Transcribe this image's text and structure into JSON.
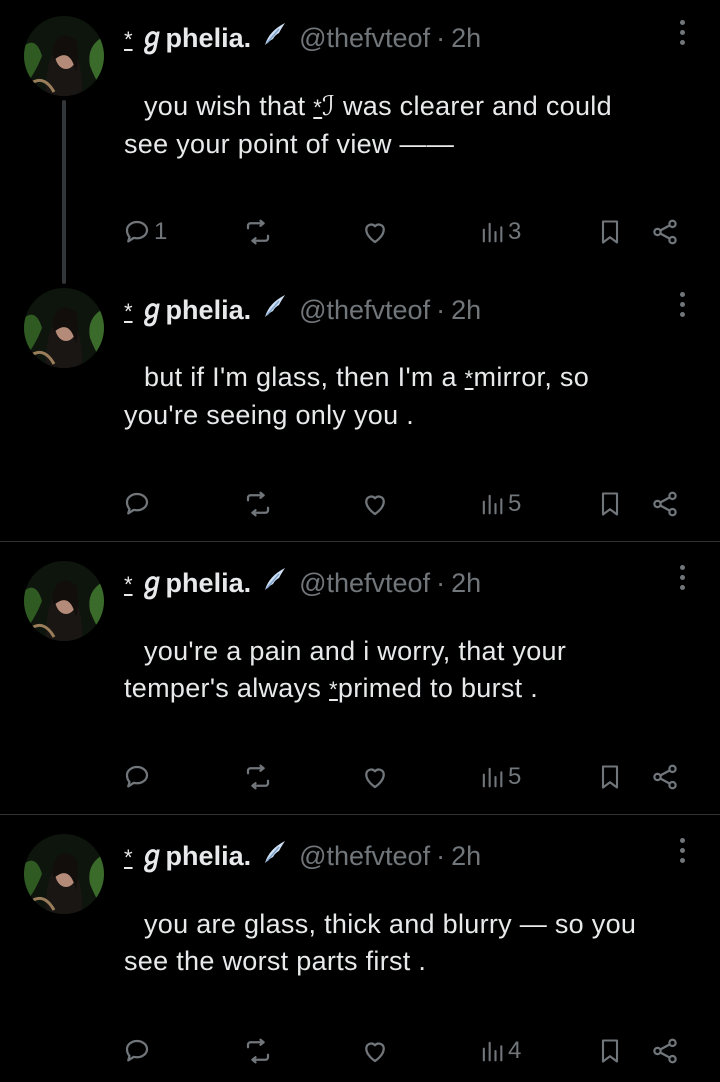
{
  "posts": [
    {
      "display_name": "ℊphelia.",
      "name_prefix": "*",
      "handle": "@thefvteof",
      "separator": "·",
      "time": "2h",
      "text_line1_a": "you wish that",
      "text_line1_star": "*",
      "text_line1_b": "ℐ was clearer and could",
      "text_line2": "see your point of view ——",
      "replies": "1",
      "reposts": "",
      "likes": "",
      "views": "3"
    },
    {
      "display_name": "ℊphelia.",
      "name_prefix": "*",
      "handle": "@thefvteof",
      "separator": "·",
      "time": "2h",
      "text_line1_a": "but if I'm glass, then I'm a",
      "text_line1_star": "*",
      "text_line1_b": "mirror, so",
      "text_line2": "you're seeing only you .",
      "replies": "",
      "reposts": "",
      "likes": "",
      "views": "5"
    },
    {
      "display_name": "ℊphelia.",
      "name_prefix": "*",
      "handle": "@thefvteof",
      "separator": "·",
      "time": "2h",
      "text_line1_a": "you're a pain and i worry, that your",
      "text_line1_star": "",
      "text_line1_b": "",
      "text_line2_a": "temper's always",
      "text_line2_star": "*",
      "text_line2_b": "primed to burst .",
      "replies": "",
      "reposts": "",
      "likes": "",
      "views": "5"
    },
    {
      "display_name": "ℊphelia.",
      "name_prefix": "*",
      "handle": "@thefvteof",
      "separator": "·",
      "time": "2h",
      "text_line1_a": "you are glass, thick and blurry — so you",
      "text_line1_star": "",
      "text_line1_b": "",
      "text_line2": "see the worst parts first .",
      "replies": "",
      "reposts": "",
      "likes": "",
      "views": "4"
    }
  ],
  "colors": {
    "background": "#000000",
    "text": "#e7e9ea",
    "muted": "#71767b",
    "divider": "#2f3336",
    "wing_icon": "#cfe0f5"
  },
  "icons": [
    "reply-icon",
    "repost-icon",
    "like-icon",
    "views-icon",
    "bookmark-icon",
    "share-icon",
    "more-icon",
    "wing-icon"
  ]
}
